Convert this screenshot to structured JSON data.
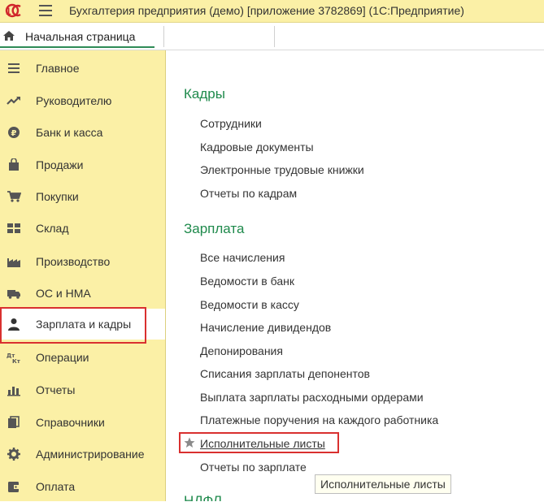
{
  "titlebar": {
    "logo_text": "1С",
    "title": "Бухгалтерия предприятия (демо) [приложение 3782869]  (1С:Предприятие)"
  },
  "tabs": {
    "home_label": "Начальная страница"
  },
  "sidebar": {
    "items": [
      {
        "label": "Главное",
        "icon": "menu-lines-icon"
      },
      {
        "label": "Руководителю",
        "icon": "trend-icon"
      },
      {
        "label": "Банк и касса",
        "icon": "ruble-coin-icon"
      },
      {
        "label": "Продажи",
        "icon": "shopping-bag-icon"
      },
      {
        "label": "Покупки",
        "icon": "cart-icon"
      },
      {
        "label": "Склад",
        "icon": "warehouse-icon"
      },
      {
        "label": "Производство",
        "icon": "factory-icon"
      },
      {
        "label": "ОС и НМА",
        "icon": "truck-icon"
      },
      {
        "label": "Зарплата и кадры",
        "icon": "person-icon",
        "active": true
      },
      {
        "label": "Операции",
        "icon": "dt-kt-icon"
      },
      {
        "label": "Отчеты",
        "icon": "bar-chart-icon"
      },
      {
        "label": "Справочники",
        "icon": "books-icon"
      },
      {
        "label": "Администрирование",
        "icon": "gear-icon"
      },
      {
        "label": "Оплата",
        "icon": "wallet-icon"
      }
    ]
  },
  "content": {
    "sections": [
      {
        "title": "Кадры",
        "links": [
          "Сотрудники",
          "Кадровые документы",
          "Электронные трудовые книжки",
          "Отчеты по кадрам"
        ]
      },
      {
        "title": "Зарплата",
        "links": [
          "Все начисления",
          "Ведомости в банк",
          "Ведомости в кассу",
          "Начисление дивидендов",
          "Депонирования",
          "Списания зарплаты депонентов",
          "Выплата зарплаты расходными ордерами",
          "Платежные поручения на каждого работника",
          "Исполнительные листы",
          "Отчеты по зарплате"
        ]
      },
      {
        "title": "НДФЛ",
        "links": []
      }
    ],
    "tooltip": "Исполнительные листы"
  },
  "colors": {
    "sidebar_bg": "#fbf0a6",
    "section_title": "#1f8a4c",
    "highlight": "#d9302f"
  }
}
